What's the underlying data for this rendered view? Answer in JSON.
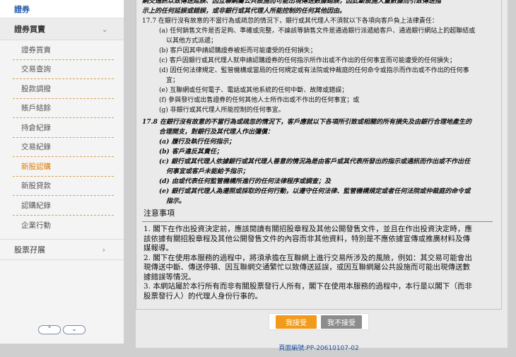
{
  "sidebar": {
    "header": "證券",
    "section": "證券買賣",
    "items": [
      {
        "label": "證券買賣",
        "active": false
      },
      {
        "label": "交易查詢",
        "active": false
      },
      {
        "label": "股款調撥",
        "active": false
      },
      {
        "label": "賬戶結餘",
        "active": false
      },
      {
        "label": "持倉紀錄",
        "active": false
      },
      {
        "label": "交易紀錄",
        "active": false
      },
      {
        "label": "新股認購",
        "active": true
      },
      {
        "label": "新股貸款",
        "active": false
      },
      {
        "label": "認購紀錄",
        "active": false
      },
      {
        "label": "企業行動",
        "active": false
      }
    ],
    "section2": "股票孖展"
  },
  "terms": {
    "top_lines": [
      "網交通訊以致傳送延誤、因互聯網屬公共設施而可能出現傳送數據錯誤，因此斷設施大量數據而引致傳送指",
      "示上的任何延誤或錯誤，或非銀行或其代理人所能控制的任何其他因由。"
    ],
    "s17_intro": "17.7 在銀行沒有故意的不當行為或疏忽的情況下，銀行或其代理人不須就以下各項向客戶負上法律責任：",
    "s17_items": [
      "(a) 任何銷售文件是否足夠、準確或完整，不論該等銷售文件是通過銀行派遞給客戶、通過銀行網站上的超聯結或",
      "以其他方式派遞；",
      "(b) 客戶因其申請認購證券被拒而可能遭受的任何損失；",
      "(c) 客戶因銀行或其代理人就申請認購證券的任何指示所作出或不作出的任何事宜而可能遭受的任何損失；",
      "(d) 因任何法律規定、監管機構或當局的任何規定或有法院或仲裁庭的任何命令或指示而作出或不作出的任何事",
      "宜；",
      "(e) 互聯網或任何電子、電話或其他系統的任何中斷、故障或錯誤；",
      "(f) 參與發行或出售證券的任何其他人士所作出或不作出的任何事宜；或",
      "(g) 非銀行或其代理人所能控制的任何事宜。"
    ],
    "s18_intro": [
      "17.8 在銀行沒有故意的不當行為或疏忽的情況下，客戶應就以下各項所引致或相關的所有損失及由銀行合理地產生的",
      "合理開支，對銀行及其代理人作出彌償："
    ],
    "s18_items": [
      "(a) 履行及執行任何指示；",
      "(b) 客戶違反其責任；",
      "(c) 銀行或其代理人依據銀行或其代理人善意的情況為是由客戶或其代表所發出的指示或通訊而作出或不作出任",
      "何事宜或客戶未能給予指示；",
      "(d) 由或代表任何監管機構所進行的任何法律程序或調查；及",
      "(e) 銀行或其代理人為遵照或採取的任何行動，以遵守任何法律、監管機構規定或者任何法院或仲裁庭的命令或",
      "指示。"
    ]
  },
  "notice": {
    "title": "注意事項",
    "lines": [
      "1. 閣下在作出投資決定前，應該閱讀有關招股章程及其他公開發售文件，並且在作出投資決定時，應",
      "該依據有關招股章程及其他公開發售文件的內容而非其他資料，特別是不應依據宣傳或推廣材料及傳",
      "媒報導。",
      "2. 閣下在使用本服務的過程中，將須承擔在互聯網上進行交易所涉及的風險，例如：其交易可能會出",
      "現傳送中斷、傳送停頓、因互聯網交通繁忙以致傳送延誤，或因互聯網屬公共設施而可能出現傳送數",
      "據錯誤等情況。",
      "3. 本網站屬於本行所有而非有關股票發行人所有，閣下在使用本服務的過程中，本行是以閣下（而非",
      "股票發行人）的代理人身份行事的。"
    ]
  },
  "buttons": {
    "accept": "我接受",
    "decline": "我不接受"
  },
  "page_code": "頁面編號:PP-20610107-02"
}
